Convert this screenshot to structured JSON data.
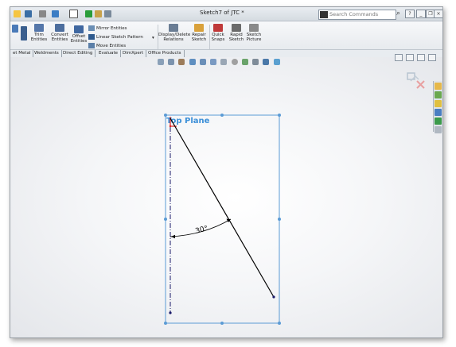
{
  "window": {
    "document_title": "Sketch7 of JTC *",
    "search_placeholder": "Search Commands"
  },
  "ribbon": {
    "trim_label": "Trim\nEntities",
    "convert_label": "Convert\nEntities",
    "offset_label": "Offset\nEntities",
    "mirror_label": "Mirror Entities",
    "linear_pattern_label": "Linear Sketch Pattern",
    "move_label": "Move Entities",
    "display_relations_label": "Display/Delete\nRelations",
    "repair_label": "Repair\nSketch",
    "quick_snaps_label": "Quick\nSnaps",
    "rapid_label": "Rapid\nSketch",
    "picture_label": "Sketch\nPicture"
  },
  "tabs": [
    {
      "label": "et Metal"
    },
    {
      "label": "Weldments"
    },
    {
      "label": "Direct Editing"
    },
    {
      "label": "Evaluate"
    },
    {
      "label": "DimXpert"
    },
    {
      "label": "Office Products"
    }
  ],
  "sketch": {
    "plane_label": "Top Plane",
    "angle_label": "30°",
    "line_color": "#000000",
    "plane_color": "#5b9bd5",
    "plane_text_color": "#3a8fd8",
    "centerline_color": "#1a1a6a"
  },
  "colors": {
    "ribbon_bg": "#eef1f4",
    "confirm_x": "#e8a0a0",
    "accent_red": "#e02020"
  }
}
